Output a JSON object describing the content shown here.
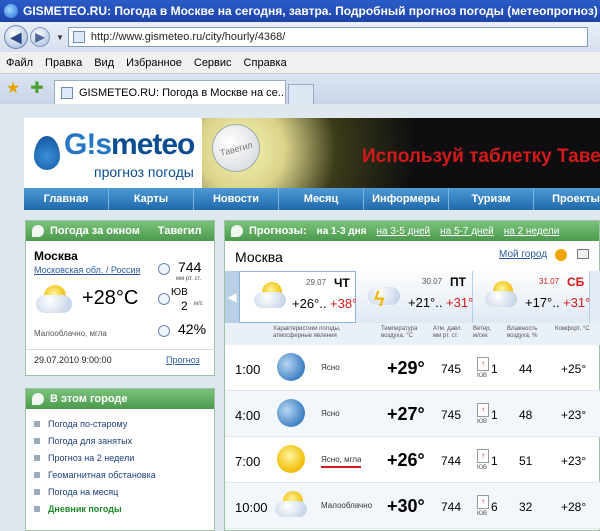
{
  "window": {
    "title": "GISMETEO.RU: Погода в Москве на сегодня, завтра. Подробный прогноз погоды (метеопрогноз) на"
  },
  "browser": {
    "url": "http://www.gismeteo.ru/city/hourly/4368/",
    "menu": [
      "Файл",
      "Правка",
      "Вид",
      "Избранное",
      "Сервис",
      "Справка"
    ],
    "tab_title": "GISMETEO.RU: Погода в Москве на се..."
  },
  "site": {
    "logo_name": "meteo",
    "logo_gis": "G!s",
    "logo_sub": "прогноз погоды",
    "banner_pill": "Тавегил",
    "banner_text": "Используй таблетку Тавег",
    "nav": [
      "Главная",
      "Карты",
      "Новости",
      "Месяц",
      "Информеры",
      "Туризм",
      "Проекты"
    ]
  },
  "now": {
    "header": "Погода за окном",
    "header_extra": "Тавегил",
    "city": "Москва",
    "region": "Московская обл. / Россия",
    "temp": "+28°C",
    "pressure": "744",
    "pressure_unit": "мм рт. ст.",
    "wind_dir": "ЮВ",
    "wind_speed": "2",
    "wind_unit": "м/с",
    "humidity": "42%",
    "condition": "Малооблачно, мгла",
    "timestamp": "29.07.2010 9:00:00",
    "forecast_link": "Прогноз"
  },
  "city_links": {
    "header": "В этом городе",
    "items": [
      {
        "label": "Погода по-старому"
      },
      {
        "label": "Погода для занятых"
      },
      {
        "label": "Прогноз на 2 недели"
      },
      {
        "label": "Геомагнитная обстановка"
      },
      {
        "label": "Погода на месяц"
      },
      {
        "label": "Дневник погоды"
      }
    ]
  },
  "forecast": {
    "header": "Прогнозы:",
    "tabs": [
      "на 1-3 дня",
      "на 3-5 дней",
      "на 5-7 дней",
      "на 2 недели"
    ],
    "city": "Москва",
    "my_city": "Мой город",
    "days": [
      {
        "date": "29.07",
        "dow": "ЧТ",
        "low": "+26°..",
        "high": "+38°"
      },
      {
        "date": "30.07",
        "dow": "ПТ",
        "low": "+21°..",
        "high": "+31°"
      },
      {
        "date": "31.07",
        "dow": "СБ",
        "low": "+17°..",
        "high": "+31°"
      }
    ],
    "columns": {
      "cond": "Характеристики погоды, атмосферные явления",
      "temp": "Температура воздуха, °C",
      "pres": "Атм. давл. мм рт. ст.",
      "wind": "Ветер, м/сек",
      "hum": "Влажность воздуха, %",
      "comfort": "Комфорт, °C"
    },
    "rows": [
      {
        "time": "1:00",
        "cond": "Ясно",
        "temp": "+29°",
        "pres": "745",
        "wdir": "ЮВ",
        "ws": "1",
        "hum": "44",
        "comfort": "+25°"
      },
      {
        "time": "4:00",
        "cond": "Ясно",
        "temp": "+27°",
        "pres": "745",
        "wdir": "ЮВ",
        "ws": "1",
        "hum": "48",
        "comfort": "+23°"
      },
      {
        "time": "7:00",
        "cond": "Ясно, мгла",
        "temp": "+26°",
        "pres": "744",
        "wdir": "ЮВ",
        "ws": "1",
        "hum": "51",
        "comfort": "+23°"
      },
      {
        "time": "10:00",
        "cond": "Малооблачно",
        "temp": "+30°",
        "pres": "744",
        "wdir": "ЮВ",
        "ws": "6",
        "hum": "32",
        "comfort": "+28°"
      }
    ]
  }
}
